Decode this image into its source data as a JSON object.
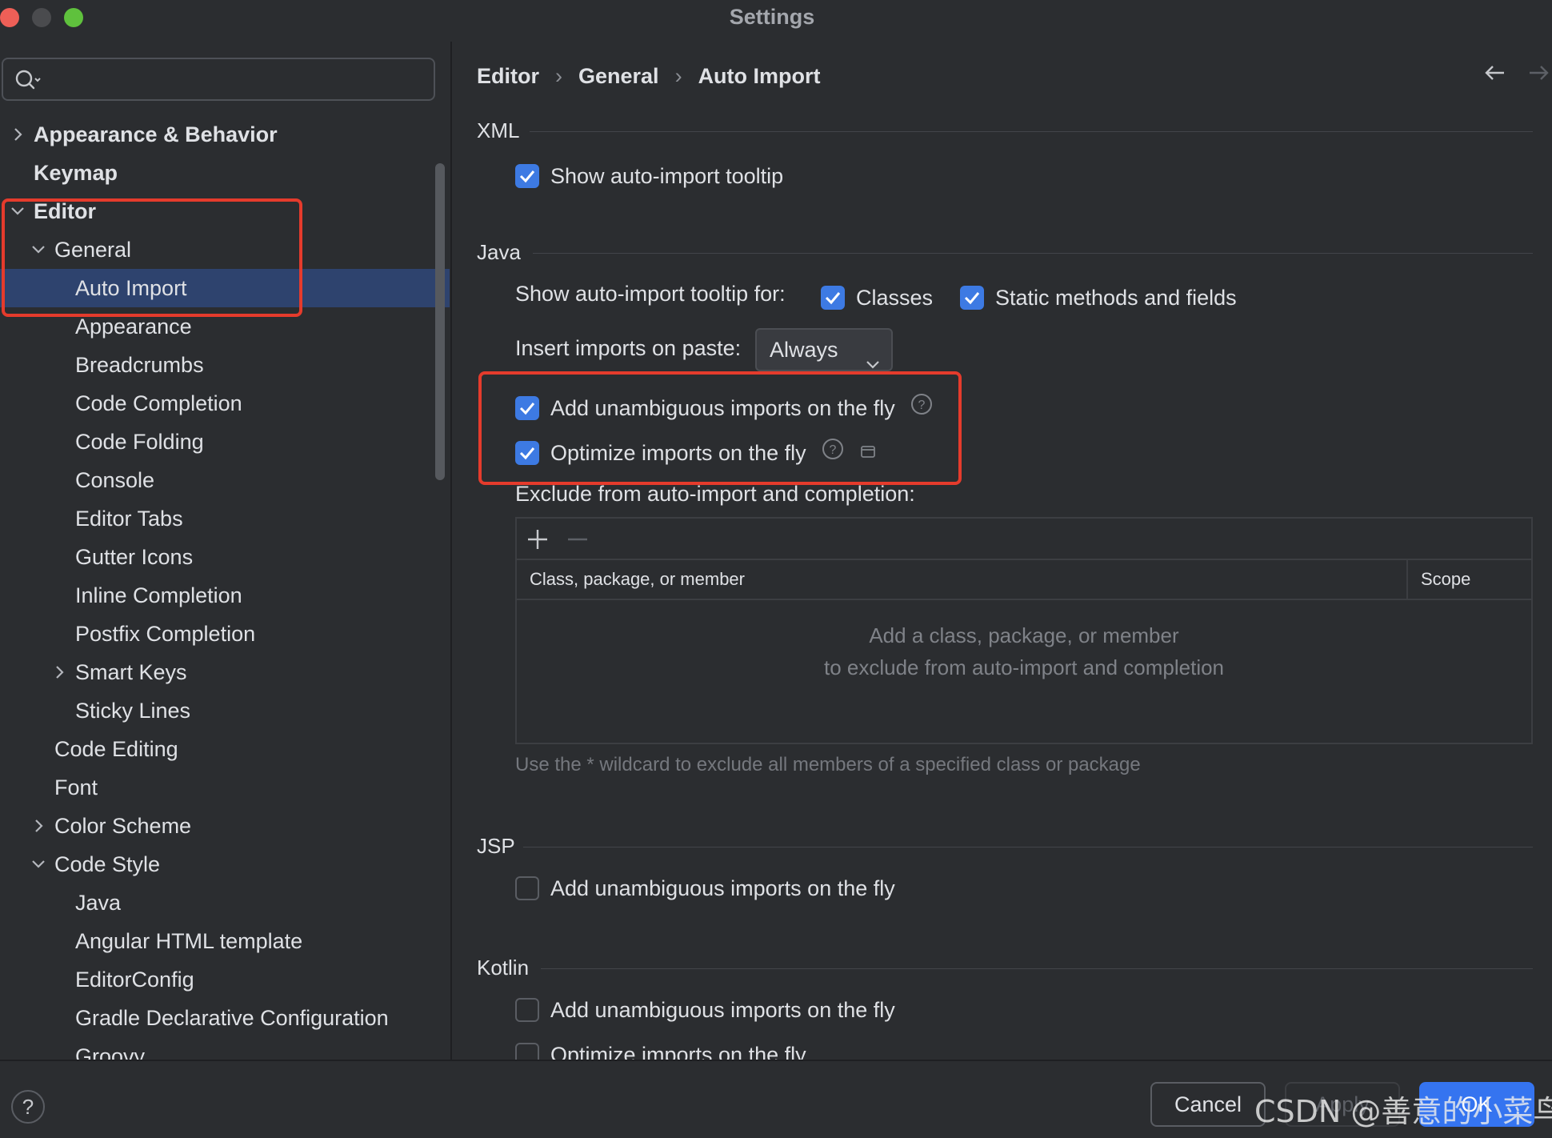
{
  "window": {
    "title": "Settings"
  },
  "search": {
    "placeholder": ""
  },
  "sidebar": {
    "items": [
      {
        "label": "Appearance & Behavior",
        "bold": true,
        "chevron": "right"
      },
      {
        "label": "Keymap",
        "bold": true,
        "chevron": "none"
      },
      {
        "label": "Editor",
        "bold": true,
        "chevron": "down"
      },
      {
        "label": "General",
        "bold": false,
        "chevron": "down"
      },
      {
        "label": "Auto Import",
        "bold": false,
        "chevron": "none",
        "selected": true
      },
      {
        "label": "Appearance",
        "bold": false,
        "chevron": "none"
      },
      {
        "label": "Breadcrumbs",
        "bold": false,
        "chevron": "none"
      },
      {
        "label": "Code Completion",
        "bold": false,
        "chevron": "none"
      },
      {
        "label": "Code Folding",
        "bold": false,
        "chevron": "none"
      },
      {
        "label": "Console",
        "bold": false,
        "chevron": "none"
      },
      {
        "label": "Editor Tabs",
        "bold": false,
        "chevron": "none"
      },
      {
        "label": "Gutter Icons",
        "bold": false,
        "chevron": "none"
      },
      {
        "label": "Inline Completion",
        "bold": false,
        "chevron": "none"
      },
      {
        "label": "Postfix Completion",
        "bold": false,
        "chevron": "none"
      },
      {
        "label": "Smart Keys",
        "bold": false,
        "chevron": "right"
      },
      {
        "label": "Sticky Lines",
        "bold": false,
        "chevron": "none"
      },
      {
        "label": "Code Editing",
        "bold": false,
        "chevron": "none"
      },
      {
        "label": "Font",
        "bold": false,
        "chevron": "none"
      },
      {
        "label": "Color Scheme",
        "bold": false,
        "chevron": "right"
      },
      {
        "label": "Code Style",
        "bold": false,
        "chevron": "down"
      },
      {
        "label": "Java",
        "bold": false,
        "chevron": "none"
      },
      {
        "label": "Angular HTML template",
        "bold": false,
        "chevron": "none"
      },
      {
        "label": "EditorConfig",
        "bold": false,
        "chevron": "none"
      },
      {
        "label": "Gradle Declarative Configuration",
        "bold": false,
        "chevron": "none"
      },
      {
        "label": "Groovy",
        "bold": false,
        "chevron": "none"
      }
    ]
  },
  "breadcrumb": {
    "items": [
      "Editor",
      "General",
      "Auto Import"
    ],
    "separator": "›"
  },
  "xml": {
    "title": "XML",
    "show_tooltip": {
      "label": "Show auto-import tooltip",
      "checked": true
    }
  },
  "java": {
    "title": "Java",
    "tooltip_for_label": "Show auto-import tooltip for:",
    "classes": {
      "label": "Classes",
      "checked": true
    },
    "static_methods": {
      "label": "Static methods and fields",
      "checked": true
    },
    "insert_on_paste_label": "Insert imports on paste:",
    "insert_on_paste_value": "Always",
    "add_unambiguous": {
      "label": "Add unambiguous imports on the fly",
      "checked": true
    },
    "optimize": {
      "label": "Optimize imports on the fly",
      "checked": true
    },
    "exclude_label": "Exclude from auto-import and completion:",
    "table": {
      "columns": [
        "Class, package, or member",
        "Scope"
      ],
      "empty_line1": "Add a class, package, or member",
      "empty_line2": "to exclude from auto-import and completion"
    },
    "hint": "Use the * wildcard to exclude all members of a specified class or package"
  },
  "jsp": {
    "title": "JSP",
    "add_unambiguous": {
      "label": "Add unambiguous imports on the fly",
      "checked": false
    }
  },
  "kotlin": {
    "title": "Kotlin",
    "add_unambiguous": {
      "label": "Add unambiguous imports on the fly",
      "checked": false
    },
    "optimize": {
      "label": "Optimize imports on the fly",
      "checked": false
    }
  },
  "footer": {
    "help": "?",
    "cancel": "Cancel",
    "apply": "Apply",
    "ok": "OK"
  },
  "watermark": "CSDN @善意的小菜鸟",
  "colors": {
    "accent": "#3574f0",
    "highlight_border": "#e53b2c",
    "selection": "#2e436e",
    "background": "#2b2d30"
  }
}
